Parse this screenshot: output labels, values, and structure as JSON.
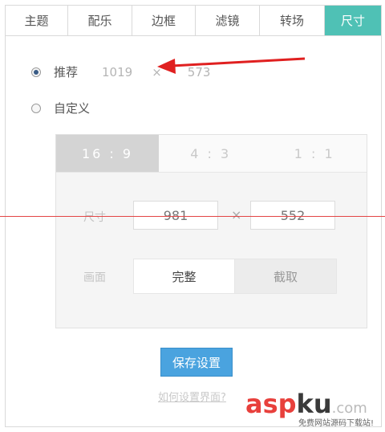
{
  "tabs": [
    {
      "label": "主题",
      "active": false
    },
    {
      "label": "配乐",
      "active": false
    },
    {
      "label": "边框",
      "active": false
    },
    {
      "label": "滤镜",
      "active": false
    },
    {
      "label": "转场",
      "active": false
    },
    {
      "label": "尺寸",
      "active": true
    }
  ],
  "recommend": {
    "label": "推荐",
    "width": "1019",
    "sep": "×",
    "height": "573",
    "selected": true
  },
  "custom": {
    "label": "自定义",
    "selected": false
  },
  "ratios": [
    "16 : 9",
    "4 : 3",
    "1 : 1"
  ],
  "size": {
    "label": "尺寸",
    "width": "981",
    "sep": "×",
    "height": "552"
  },
  "frame": {
    "label": "画面",
    "full": "完整",
    "crop": "截取"
  },
  "save_label": "保存设置",
  "help_link": "如何设置界面?",
  "watermark": {
    "brand_a": "asp",
    "brand_b": "ku",
    "suffix": ".com",
    "tagline": "免费网站源码下载站!"
  },
  "colors": {
    "accent": "#4fc1b5",
    "button": "#4aa3df",
    "arrow": "#e02020"
  }
}
